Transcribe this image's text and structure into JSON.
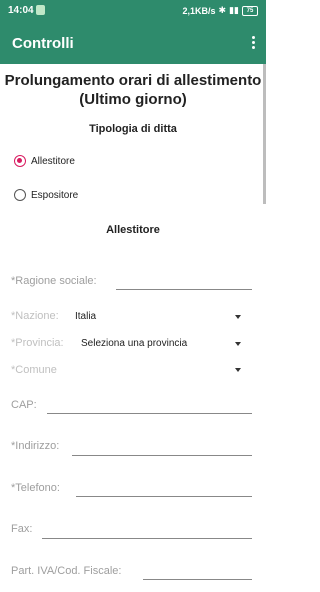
{
  "statusbar": {
    "time": "14:04",
    "network": "2,1KB/s",
    "battery": "75"
  },
  "appbar": {
    "title": "Controlli"
  },
  "page": {
    "title": "Prolungamento orari di allestimento (Ultimo giorno)",
    "type_heading": "Tipologia di ditta",
    "options": [
      {
        "label": "Allestitore",
        "selected": true
      },
      {
        "label": "Espositore",
        "selected": false
      }
    ],
    "section_title": "Allestitore"
  },
  "form": {
    "ragione_sociale": "*Ragione sociale:",
    "nazione_label": "*Nazione:",
    "nazione_value": "Italia",
    "provincia_label": "*Provincia:",
    "provincia_value": "Seleziona una provincia",
    "comune_label": "*Comune",
    "cap": "CAP:",
    "indirizzo": "*Indirizzo:",
    "telefono": "*Telefono:",
    "fax": "Fax:",
    "piva": "Part. IVA/Cod. Fiscale:"
  },
  "colors": {
    "primary": "#2e8b6c",
    "accent": "#d81b60"
  }
}
